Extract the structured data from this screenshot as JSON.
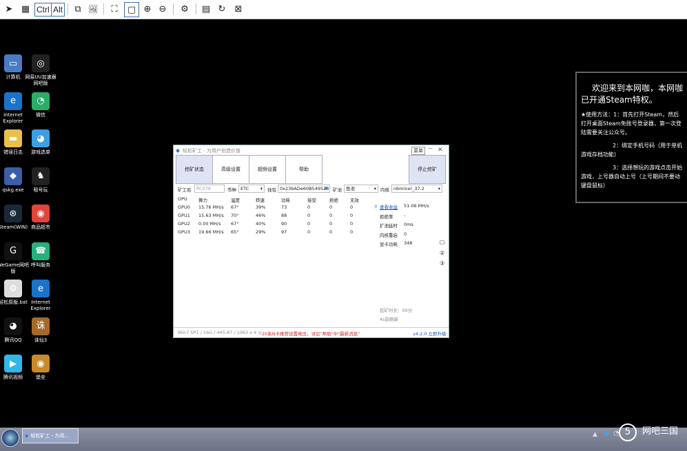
{
  "toolbar": {
    "items": [
      {
        "name": "send-icon",
        "glyph": "➤"
      },
      {
        "name": "grid-icon",
        "glyph": "▦"
      },
      {
        "name": "ctrl-key",
        "label": "Ctrl"
      },
      {
        "name": "alt-key",
        "label": "Alt"
      },
      {
        "name": "copy-icon",
        "glyph": "⧉"
      },
      {
        "name": "image-icon",
        "glyph": "🖼"
      },
      {
        "name": "fit-screen-icon",
        "glyph": "⛶"
      },
      {
        "name": "actual-size-icon",
        "glyph": "▢"
      },
      {
        "name": "zoom-in-icon",
        "glyph": "⊕"
      },
      {
        "name": "zoom-out-icon",
        "glyph": "⊖"
      },
      {
        "name": "settings-icon",
        "glyph": "⚙"
      },
      {
        "name": "note-icon",
        "glyph": "▤"
      },
      {
        "name": "refresh-icon",
        "glyph": "↻"
      },
      {
        "name": "close-screen-icon",
        "glyph": "⊠"
      }
    ]
  },
  "desktop": {
    "icons": [
      {
        "label": "计算机",
        "color": "#4a7cc4",
        "glyph": "▭"
      },
      {
        "label": "网易UU加速器网吧版",
        "color": "#222",
        "glyph": "◎"
      },
      {
        "label": "Internet Explorer",
        "color": "#1a73c8",
        "glyph": "e"
      },
      {
        "label": "微信",
        "color": "#2aae67",
        "glyph": "◔"
      },
      {
        "label": "错误日志",
        "color": "#e8c04a",
        "glyph": "▬"
      },
      {
        "label": "游戏选单",
        "color": "#3aa0e0",
        "glyph": "◕"
      },
      {
        "label": "qskg.exe",
        "color": "#3a5ea8",
        "glyph": "◆"
      },
      {
        "label": "租号玩",
        "color": "#222",
        "glyph": "♞"
      },
      {
        "label": "Steam(WIN)",
        "color": "#1b2838",
        "glyph": "⊛"
      },
      {
        "label": "商品超市",
        "color": "#e0443a",
        "glyph": "◉"
      },
      {
        "label": "WeGame网吧版",
        "color": "#111",
        "glyph": "G"
      },
      {
        "label": "呼叫服务",
        "color": "#26b07a",
        "glyph": "☎"
      },
      {
        "label": "轻松原版.bat",
        "color": "#ddd",
        "glyph": "⚙"
      },
      {
        "label": "Internet Explorer",
        "color": "#1a73c8",
        "glyph": "e"
      },
      {
        "label": "腾讯QQ",
        "color": "#111",
        "glyph": "◕"
      },
      {
        "label": "诛仙3",
        "color": "#a46a2a",
        "glyph": "诛"
      },
      {
        "label": "腾讯视频",
        "color": "#35b6e8",
        "glyph": "▶"
      },
      {
        "label": "堡垒",
        "color": "#c88a2a",
        "glyph": "◉"
      }
    ]
  },
  "panel": {
    "heading": "欢迎来到本网咖，本网咖已开通Steam特权。",
    "p1": "★使用方法：1：首先打开Steam，然后打开桌面Steam免账号登录器，第一次登陆需要关注公众号。",
    "p2": "2：绑定手机号码（用于单机游戏存档功能）",
    "p3": "3：选择想玩的游戏点击开始游戏，上号器自动上号（上号期间不要动键盘鼠标）"
  },
  "miner": {
    "title": "轻松矿工 - 为用户创造价值",
    "menu_label": "菜单",
    "tabs": [
      "挖矿状态",
      "高级设置",
      "超频设置",
      "帮助"
    ],
    "stop_label": "停止挖矿",
    "worker_label": "矿工名",
    "worker_value": "PC079",
    "coin_label": "币种",
    "coin_value": "ETC",
    "wallet_label": "钱包",
    "wallet_value": "0x23bADe60B549528",
    "pool_label": "矿池",
    "pool_value": "鱼池",
    "kernel_label": "内核",
    "kernel_value": "nbminer_37.2",
    "gpu_headers": [
      "GPU",
      "算力",
      "温度",
      "转速",
      "功耗",
      "接受",
      "拒绝",
      "无效"
    ],
    "gpus": [
      [
        "GPU0",
        "15.76 MH/s",
        "67°",
        "39%",
        "73",
        "0",
        "0",
        "0"
      ],
      [
        "GPU1",
        "15.63 MH/s",
        "70°",
        "46%",
        "88",
        "0",
        "0",
        "0"
      ],
      [
        "GPU2",
        "0.00 MH/s",
        "67°",
        "40%",
        "90",
        "0",
        "0",
        "0"
      ],
      [
        "GPU3",
        "19.66 MH/s",
        "65°",
        "29%",
        "97",
        "0",
        "0",
        "0"
      ]
    ],
    "stats": [
      {
        "label": "查看收益",
        "value": "51.06 MH/s",
        "link": true
      },
      {
        "label": "拒绝率",
        "value": "-"
      },
      {
        "label": "扩池延时",
        "value": "0ms"
      },
      {
        "label": "内核重启",
        "value": "0"
      },
      {
        "label": "显卡功耗",
        "value": "348"
      }
    ],
    "mining_time": "挖矿时长：00分",
    "refresh_text": "4s前刷新",
    "sysinfo": "Win7 SP1 / 16G / 445.87 / 1063 x 4 ◎",
    "notice": "20系N卡推荐设置电压，详见\"帮助\"中\"最新消息\"",
    "version": "v4.2.0 立即升级"
  },
  "taskbar": {
    "task_label": "轻松矿工 - 为用..."
  },
  "watermark": {
    "brand": "网吧三国"
  }
}
